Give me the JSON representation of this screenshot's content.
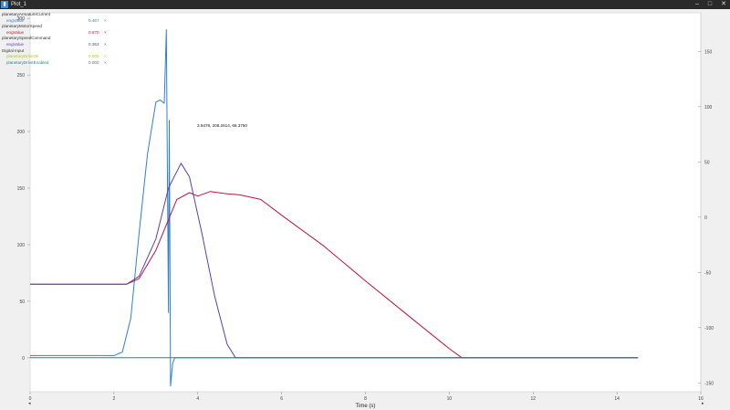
{
  "window": {
    "title": "Plot_1",
    "app_icon": "plot-app-icon",
    "controls": [
      "minimize-icon",
      "maximize-icon",
      "close-icon"
    ]
  },
  "legend": {
    "groups": [
      {
        "name": "planetaryArmatureCurrent",
        "items": [
          {
            "label": "engValue",
            "value": "0.467",
            "color": "#2f7fd6"
          }
        ]
      },
      {
        "name": "planetaryMotorSpeed",
        "items": [
          {
            "label": "engValue",
            "value": "0.670",
            "color": "#c0143c"
          }
        ]
      },
      {
        "name": "planetarySpeedCommand",
        "items": [
          {
            "label": "engValue",
            "value": "0.353",
            "color": "#5b3fb0"
          }
        ]
      },
      {
        "name": "Digital Input",
        "items": [
          {
            "label": "planetaryDriveOk",
            "value": "0.000",
            "color": "#a6c934"
          },
          {
            "label": "planetaryDriveEnabled",
            "value": "0.000",
            "color": "#1f8a84"
          }
        ]
      }
    ],
    "marker": "×"
  },
  "cursor_readout": "3.9478, 208.2614, 66.3750",
  "chart_data": {
    "type": "line",
    "xlabel": "Time (s)",
    "xlim": [
      0,
      16
    ],
    "ylim": [
      -30,
      305
    ],
    "y2lim": [
      -158,
      185
    ],
    "x_ticks": [
      0,
      2,
      4,
      6,
      8,
      10,
      12,
      14,
      16
    ],
    "y_ticks": [
      0,
      50,
      100,
      150,
      200,
      250,
      300
    ],
    "y2_ticks": [
      -150,
      -100,
      -50,
      0,
      50,
      100,
      150
    ],
    "series": [
      {
        "name": "planetaryArmatureCurrent engValue",
        "axis": "left",
        "color": "#2f7fd6",
        "x": [
          0,
          0.5,
          1.0,
          1.5,
          2.0,
          2.2,
          2.4,
          2.6,
          2.8,
          3.0,
          3.1,
          3.2,
          3.25,
          3.3,
          3.32,
          3.35,
          3.4,
          3.45,
          3.5,
          3.55,
          3.6,
          4.0,
          6,
          8,
          10,
          12,
          14,
          14.5
        ],
        "y": [
          2,
          2,
          2,
          2,
          2,
          5,
          35,
          110,
          180,
          226,
          228,
          225,
          290,
          40,
          210,
          -25,
          -5,
          0,
          0,
          0,
          0,
          0,
          0,
          0,
          0,
          0,
          0,
          0
        ]
      },
      {
        "name": "planetaryMotorSpeed engValue",
        "axis": "left",
        "color": "#c0143c",
        "x": [
          0,
          2.3,
          2.6,
          3.0,
          3.5,
          3.8,
          4.0,
          4.3,
          4.7,
          5.0,
          5.5,
          6.0,
          7.0,
          8.0,
          9.0,
          10.0,
          10.3,
          11,
          12,
          14,
          14.5
        ],
        "y": [
          65,
          65,
          70,
          95,
          140,
          146,
          143,
          147,
          145,
          144,
          140,
          126,
          99,
          68,
          38,
          8,
          0,
          0,
          0,
          0,
          0
        ]
      },
      {
        "name": "planetarySpeedCommand engValue",
        "axis": "left",
        "color": "#5b3fb0",
        "x": [
          0,
          2.3,
          2.6,
          3.0,
          3.3,
          3.6,
          3.8,
          4.1,
          4.4,
          4.7,
          4.9,
          5.0,
          6,
          8,
          10,
          14.5
        ],
        "y": [
          65,
          65,
          72,
          105,
          150,
          172,
          160,
          110,
          55,
          12,
          0,
          0,
          0,
          0,
          0,
          0
        ]
      },
      {
        "name": "planetaryDriveEnabled",
        "axis": "left",
        "color": "#1f8a84",
        "x": [
          0,
          14.5
        ],
        "y": [
          0,
          0
        ]
      }
    ]
  }
}
